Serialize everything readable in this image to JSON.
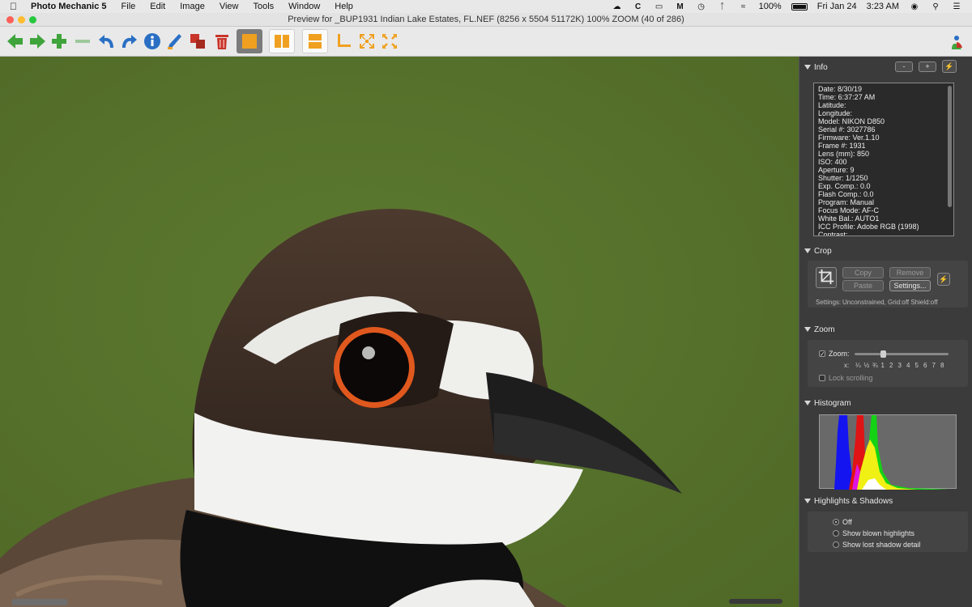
{
  "menubar": {
    "app": "Photo Mechanic 5",
    "items": [
      "File",
      "Edit",
      "Image",
      "View",
      "Tools",
      "Window",
      "Help"
    ],
    "battery": "100%",
    "date": "Fri Jan 24",
    "time": "3:23 AM",
    "status_icons": [
      "creative-cloud-icon",
      "c-icon",
      "airplay-icon",
      "malwarebytes-icon",
      "time-machine-icon",
      "bluetooth-icon",
      "wifi-icon",
      "battery-icon",
      "user-icon",
      "search-icon",
      "control-center-icon"
    ]
  },
  "window": {
    "title": "Preview for _BUP1931 Indian Lake Estates, FL.NEF (8256 x 5504 51172K) 100% ZOOM (40 of 286)"
  },
  "toolbar": {
    "buttons": [
      "previous-icon",
      "next-icon",
      "add-icon",
      "remove-icon",
      "rotate-left-icon",
      "rotate-right-icon",
      "info-icon",
      "edit-icon",
      "copy-icon",
      "trash-icon",
      "single-view-icon",
      "side-by-side-icon",
      "stacked-view-icon",
      "crop-corner-icon",
      "fit-icon",
      "expand-icon",
      "app-logo-icon"
    ]
  },
  "info": {
    "header": "Info",
    "btn_minus": "-",
    "btn_plus": "+",
    "lines": [
      "Date: 8/30/19",
      "Time: 6:37:27 AM",
      "Latitude:",
      "Longitude:",
      "Model: NIKON D850",
      "Serial #: 3027786",
      "Firmware: Ver.1.10",
      "Frame #: 1931",
      "Lens (mm): 850",
      "ISO: 400",
      "Aperture: 9",
      "Shutter: 1/1250",
      "Exp. Comp.: 0.0",
      "Flash Comp.: 0.0",
      "Program: Manual",
      "Focus Mode: AF-C",
      "White Bal.: AUTO1",
      "ICC Profile: Adobe RGB (1998)",
      "Contrast:"
    ]
  },
  "crop": {
    "header": "Crop",
    "copy": "Copy",
    "remove": "Remove",
    "paste": "Paste",
    "settings": "Settings...",
    "settings_label": "Settings:",
    "settings_value": "Unconstrained, Grid:off Shield:off"
  },
  "zoom": {
    "header": "Zoom",
    "label": "Zoom:",
    "checked": true,
    "slider_level": 0.3,
    "x_label": "x:",
    "ticks": [
      "¼",
      "½",
      "¾",
      "1",
      "2",
      "3",
      "4",
      "5",
      "6",
      "7",
      "8"
    ],
    "lock_label": "Lock scrolling"
  },
  "histogram": {
    "header": "Histogram"
  },
  "highlights": {
    "header": "Highlights & Shadows",
    "options": [
      "Off",
      "Show blown highlights",
      "Show lost shadow detail"
    ],
    "selected": 0
  },
  "colors": {
    "background_green": "#56712b",
    "panel": "#3b3b3b",
    "toolbar_green": "#3fa43c",
    "toolbar_blue": "#2a6fc4",
    "toolbar_orange": "#f0a020",
    "toolbar_red": "#c8352a"
  }
}
